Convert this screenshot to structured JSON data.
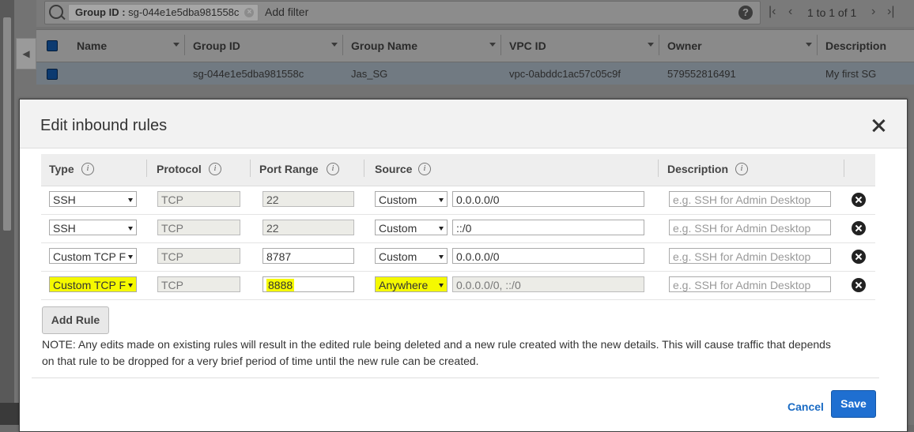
{
  "filter": {
    "token_key": "Group ID : ",
    "token_value": "sg-044e1e5dba981558c",
    "add_filter": "Add filter",
    "help": "?",
    "pagination": "1 to 1 of 1"
  },
  "grid": {
    "columns": [
      "Name",
      "Group ID",
      "Group Name",
      "VPC ID",
      "Owner",
      "Description"
    ],
    "row": {
      "name": "",
      "group_id": "sg-044e1e5dba981558c",
      "group_name": "Jas_SG",
      "vpc_id": "vpc-0abddc1ac57c05c9f",
      "owner": "579552816491",
      "description": "My first SG"
    }
  },
  "modal": {
    "title": "Edit inbound rules",
    "headers": {
      "type": "Type",
      "protocol": "Protocol",
      "port_range": "Port Range",
      "source": "Source",
      "description": "Description"
    },
    "rules": [
      {
        "type": "SSH",
        "protocol": "TCP",
        "port": "22",
        "source_type": "Custom",
        "source": "0.0.0.0/0",
        "description_placeholder": "e.g. SSH for Admin Desktop"
      },
      {
        "type": "SSH",
        "protocol": "TCP",
        "port": "22",
        "source_type": "Custom",
        "source": "::/0",
        "description_placeholder": "e.g. SSH for Admin Desktop"
      },
      {
        "type": "Custom TCP F",
        "protocol": "TCP",
        "port": "8787",
        "source_type": "Custom",
        "source": "0.0.0.0/0",
        "description_placeholder": "e.g. SSH for Admin Desktop"
      },
      {
        "type": "Custom TCP F",
        "protocol": "TCP",
        "port": "8888",
        "source_type": "Anywhere",
        "source": "0.0.0.0/0, ::/0",
        "description_placeholder": "e.g. SSH for Admin Desktop"
      }
    ],
    "add_rule": "Add Rule",
    "note": "NOTE: Any edits made on existing rules will result in the edited rule being deleted and a new rule created with the new details. This will cause traffic that depends on that rule to be dropped for a very brief period of time until the new rule can be created.",
    "cancel": "Cancel",
    "save": "Save"
  },
  "colors": {
    "highlight": "#f5f900",
    "primary": "#1f6fd1",
    "link": "#1a6bc4"
  },
  "icons": [
    "search-icon",
    "close-icon",
    "help-icon",
    "info-icon",
    "remove-rule-icon",
    "first-page-icon",
    "prev-page-icon",
    "next-page-icon",
    "last-page-icon"
  ]
}
